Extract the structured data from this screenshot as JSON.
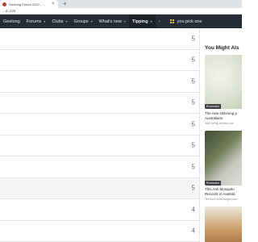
{
  "browser": {
    "tab_title": "Geelong Forum 2022 - ...",
    "close_glyph": "×",
    "new_tab_glyph": "+",
    "url": "...d=225"
  },
  "nav": {
    "items": [
      {
        "label": "Geelong"
      },
      {
        "label": "Forums"
      },
      {
        "label": "Clubs"
      },
      {
        "label": "Groups"
      },
      {
        "label": "What's new"
      },
      {
        "label": "Tipping"
      }
    ],
    "caret": "▾",
    "scroll_arrow": "›",
    "user_label": "you pick one",
    "accent_color": "#f1c40f"
  },
  "rows": [
    {
      "value": "5",
      "highlighted": false
    },
    {
      "value": "5",
      "highlighted": false
    },
    {
      "value": "5",
      "highlighted": false
    },
    {
      "value": "5",
      "highlighted": false
    },
    {
      "value": "5",
      "highlighted": false
    },
    {
      "value": "5",
      "highlighted": false
    },
    {
      "value": "5",
      "highlighted": false
    },
    {
      "value": "5",
      "highlighted": true
    },
    {
      "value": "4",
      "highlighted": false
    },
    {
      "value": "4",
      "highlighted": false
    }
  ],
  "sidebar": {
    "title": "You Might Als",
    "promoted_label": "Promoted",
    "ads": [
      {
        "title_line1": "The new slimming p",
        "title_line2": "Australians",
        "source": "Well being review.com"
      },
      {
        "title_line1": "This Anti Mosquito",
        "title_line2": "Records in Australi",
        "source": "TechnoTrendGadget.com"
      },
      {
        "title_line1": "",
        "title_line2": "",
        "source": ""
      }
    ]
  }
}
